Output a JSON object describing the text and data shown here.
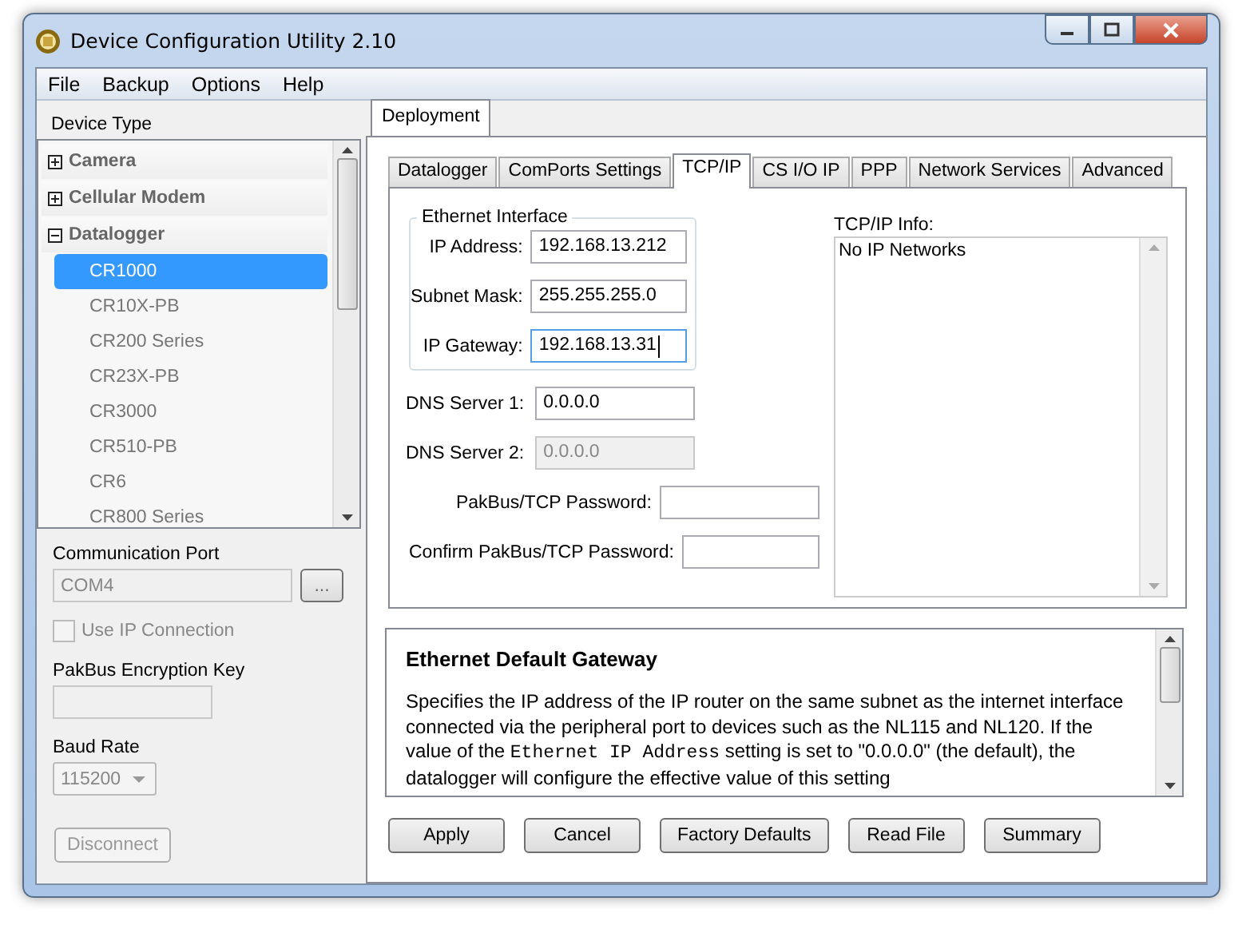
{
  "window": {
    "title": "Device Configuration Utility 2.10"
  },
  "menu": [
    "File",
    "Backup",
    "Options",
    "Help"
  ],
  "sidebar": {
    "heading": "Device Type",
    "tree": [
      {
        "label": "Camera",
        "expanded": false
      },
      {
        "label": "Cellular Modem",
        "expanded": false
      },
      {
        "label": "Datalogger",
        "expanded": true,
        "children": [
          {
            "label": "CR1000",
            "selected": true
          },
          {
            "label": "CR10X-PB",
            "selected": false
          },
          {
            "label": "CR200 Series",
            "selected": false
          },
          {
            "label": "CR23X-PB",
            "selected": false
          },
          {
            "label": "CR3000",
            "selected": false
          },
          {
            "label": "CR510-PB",
            "selected": false
          },
          {
            "label": "CR6",
            "selected": false
          },
          {
            "label": "CR800 Series",
            "selected": false
          }
        ]
      }
    ],
    "comm_port": {
      "label": "Communication Port",
      "value": "COM4",
      "disabled": true,
      "browse": "..."
    },
    "use_ip": {
      "label": "Use IP Connection",
      "checked": false,
      "disabled": true
    },
    "encryption": {
      "label": "PakBus Encryption Key",
      "disabled": true
    },
    "baud": {
      "label": "Baud Rate",
      "value": "115200",
      "disabled": true
    },
    "disconnect": {
      "label": "Disconnect",
      "disabled": true
    }
  },
  "outer_tabs": [
    {
      "label": "Deployment",
      "selected": true
    }
  ],
  "tabs": [
    {
      "label": "Datalogger",
      "selected": false
    },
    {
      "label": "ComPorts Settings",
      "selected": false
    },
    {
      "label": "TCP/IP",
      "selected": true
    },
    {
      "label": "CS I/O IP",
      "selected": false
    },
    {
      "label": "PPP",
      "selected": false
    },
    {
      "label": "Network Services",
      "selected": false
    },
    {
      "label": "Advanced",
      "selected": false
    }
  ],
  "ethernet": {
    "title": "Ethernet Interface",
    "fields": [
      {
        "label": "IP Address:",
        "value": "192.168.13.212",
        "focused": false
      },
      {
        "label": "Subnet Mask:",
        "value": "255.255.255.0",
        "focused": false
      },
      {
        "label": "IP Gateway:",
        "value": "192.168.13.31",
        "focused": true
      }
    ]
  },
  "dns": [
    {
      "label": "DNS Server 1:",
      "value": "0.0.0.0",
      "disabled": false
    },
    {
      "label": "DNS Server 2:",
      "value": "0.0.0.0",
      "disabled": true
    }
  ],
  "passwords": [
    {
      "label": "PakBus/TCP Password:"
    },
    {
      "label": "Confirm PakBus/TCP Password:"
    }
  ],
  "info": {
    "label": "TCP/IP Info:",
    "text": "No IP Networks"
  },
  "help": {
    "title": "Ethernet Default Gateway",
    "paragraph": [
      {
        "kind": "text",
        "text": "Specifies the IP address of the IP router on the same subnet as the internet interface connected via the peripheral port to devices such as the NL115 and NL120. If the value of the "
      },
      {
        "kind": "code",
        "text": "Ethernet IP Address"
      },
      {
        "kind": "text",
        "text": " setting is set to \"0.0.0.0\" (the default), the datalogger will configure the effective value of this setting"
      }
    ]
  },
  "buttons": [
    "Apply",
    "Cancel",
    "Factory Defaults",
    "Read File",
    "Summary"
  ]
}
